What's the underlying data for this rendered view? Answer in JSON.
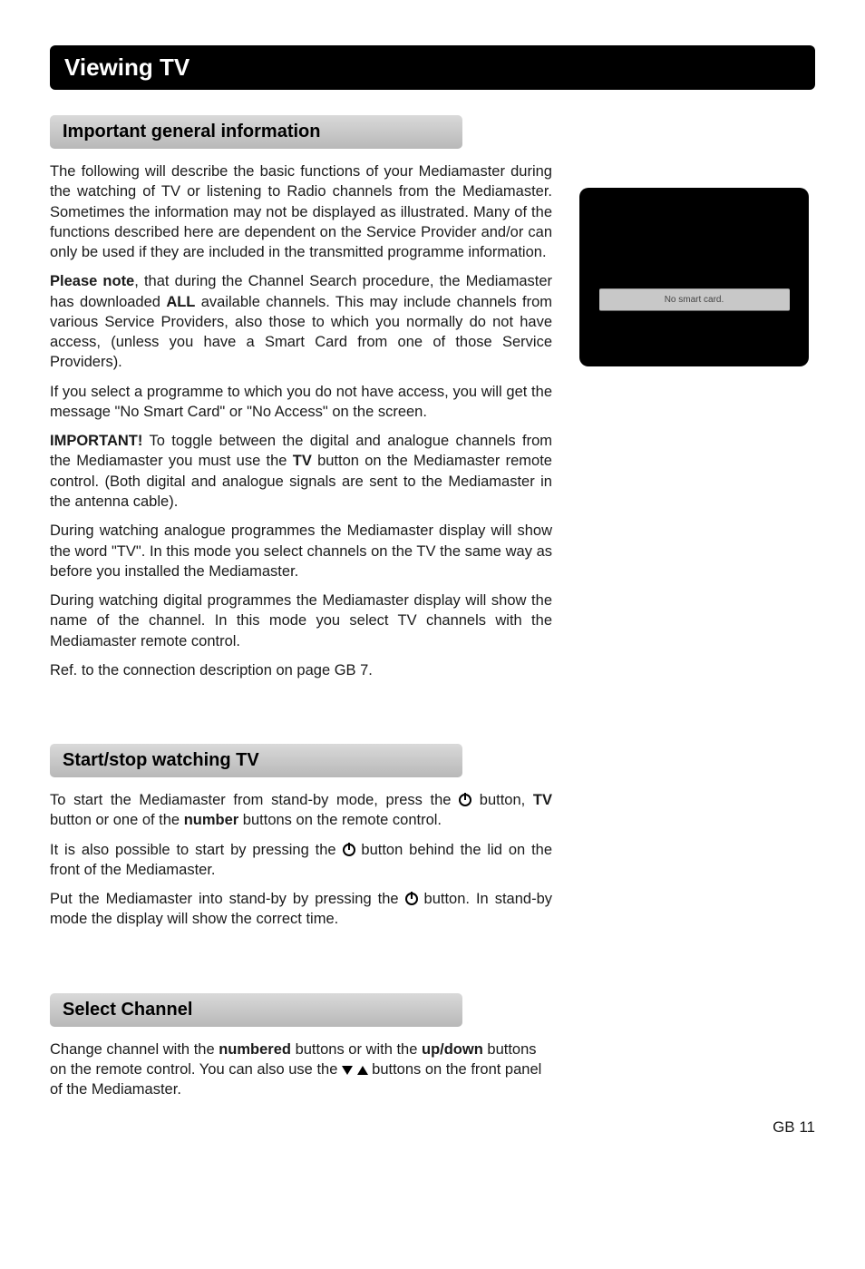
{
  "page": {
    "title": "Viewing TV",
    "footer": "GB 11"
  },
  "sections": {
    "important": {
      "heading": "Important general information",
      "p1a": "The following will describe the basic functions of your Mediamaster during the watching of TV or listening to Radio channels from the Mediamaster. Sometimes the information may not be displayed as illustrated. Many of the functions described here are dependent on the Service Provider and/or can only be used if they are included in the transmitted programme information.",
      "p2a": "Please note",
      "p2b": ", that during the Channel Search procedure, the Mediamaster has downloaded ",
      "p2c": "ALL",
      "p2d": " available channels. This may include channels from various Service Providers, also those to which you normally do not have access, (unless you have a Smart Card from one of those Service Providers).",
      "p3": "If you select a programme to which you do not have access, you will get the message \"No Smart Card\" or \"No Access\" on the screen.",
      "p4a": "IMPORTANT!",
      "p4b": " To toggle between the digital and analogue channels from the Mediamaster you must use the ",
      "p4c": "TV",
      "p4d": " button on the Mediamaster remote control. (Both digital and analogue signals are sent to the Mediamaster in the antenna cable).",
      "p5": "During watching analogue programmes the Mediamaster display will show the word \"TV\". In this mode you select channels on the TV the same way as before you installed the Mediamaster.",
      "p6": "During watching digital programmes the Mediamaster display will show the name of the channel. In this mode you select TV channels with the Mediamaster remote control.",
      "p7": "Ref. to the connection description on page GB 7."
    },
    "startstop": {
      "heading": "Start/stop watching TV",
      "p1a": "To start the Mediamaster from stand-by mode, press the ",
      "p1b": " button, ",
      "p1c": "TV",
      "p1d": " button or one of the ",
      "p1e": "number",
      "p1f": " buttons on the remote control.",
      "p2a": "It is also possible to start by pressing the ",
      "p2b": " button behind the lid on the front of the Mediamaster.",
      "p3a": "Put the Mediamaster into stand-by by pressing the ",
      "p3b": " button. In stand-by mode the display will show the correct time."
    },
    "select": {
      "heading": "Select Channel",
      "p1a": "Change channel with the ",
      "p1b": "numbered",
      "p1c": " buttons or with the ",
      "p1d": "up/down",
      "p1e": " buttons on the remote control. You can also use the ",
      "p1f": " buttons on the front panel of the Mediamaster."
    }
  },
  "screenshot": {
    "message": "No smart card."
  }
}
